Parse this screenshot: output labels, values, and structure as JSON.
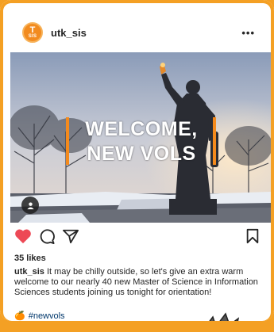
{
  "post": {
    "username": "utk_sis",
    "avatar": {
      "top": "T",
      "bottom": "SIS"
    },
    "more": "•••",
    "image_text_line1": "WELCOME,",
    "image_text_line2": "NEW VOLS",
    "likes": "35 likes",
    "caption_user": "utk_sis",
    "caption_text": " It may be chilly outside, so let's give an extra warm welcome to our nearly 40 new Master of Science in Information Sciences students joining us tonight for orientation!",
    "hashtag_emoji": "🍊",
    "hashtag": "#newvols"
  },
  "icons": [
    "heart-icon",
    "comment-icon",
    "share-icon",
    "bookmark-icon",
    "person-tag-icon"
  ],
  "colors": {
    "accent": "#f4a024",
    "heart": "#ed4956",
    "brand_orange": "#f48a1c"
  }
}
